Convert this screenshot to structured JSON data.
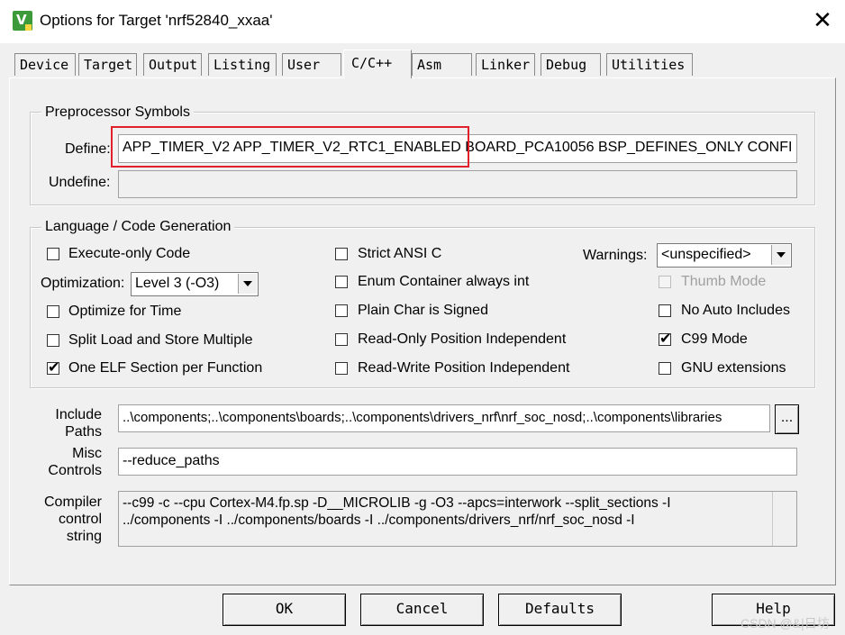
{
  "window": {
    "title": "Options for Target 'nrf52840_xxaa'",
    "close_glyph": "✕",
    "app_icon_letter": "V"
  },
  "tabs": [
    {
      "label": "Device"
    },
    {
      "label": "Target"
    },
    {
      "label": "Output"
    },
    {
      "label": "Listing"
    },
    {
      "label": "User"
    },
    {
      "label": "C/C++",
      "active": true
    },
    {
      "label": "Asm"
    },
    {
      "label": "Linker"
    },
    {
      "label": "Debug"
    },
    {
      "label": "Utilities"
    }
  ],
  "preprocessor": {
    "legend": "Preprocessor Symbols",
    "define_label": "Define:",
    "define_value": "APP_TIMER_V2 APP_TIMER_V2_RTC1_ENABLED BOARD_PCA10056 BSP_DEFINES_ONLY CONFI",
    "undefine_label": "Undefine:",
    "undefine_value": ""
  },
  "language": {
    "legend": "Language / Code Generation",
    "execute_only": {
      "label": "Execute-only Code",
      "checked": false
    },
    "optimization_label": "Optimization:",
    "optimization_value": "Level 3 (-O3)",
    "optimize_time": {
      "label": "Optimize for Time",
      "checked": false
    },
    "split_load": {
      "label": "Split Load and Store Multiple",
      "checked": false
    },
    "one_elf": {
      "label": "One ELF Section per Function",
      "checked": true
    },
    "strict_ansi": {
      "label": "Strict ANSI C",
      "checked": false
    },
    "enum_container": {
      "label": "Enum Container always int",
      "checked": false
    },
    "plain_char": {
      "label": "Plain Char is Signed",
      "checked": false
    },
    "ro_pi": {
      "label": "Read-Only Position Independent",
      "checked": false
    },
    "rw_pi": {
      "label": "Read-Write Position Independent",
      "checked": false
    },
    "warnings_label": "Warnings:",
    "warnings_value": "<unspecified>",
    "thumb_mode": {
      "label": "Thumb Mode",
      "checked": false,
      "disabled": true
    },
    "no_auto_includes": {
      "label": "No Auto Includes",
      "checked": false
    },
    "c99_mode": {
      "label": "C99 Mode",
      "checked": true
    },
    "gnu_ext": {
      "label": "GNU extensions",
      "checked": false
    }
  },
  "include": {
    "label_line1": "Include",
    "label_line2": "Paths",
    "value": "..\\components;..\\components\\boards;..\\components\\drivers_nrf\\nrf_soc_nosd;..\\components\\libraries",
    "browse_label": "..."
  },
  "misc": {
    "label_line1": "Misc",
    "label_line2": "Controls",
    "value": "--reduce_paths"
  },
  "compiler": {
    "label_line1": "Compiler",
    "label_line2": "control",
    "label_line3": "string",
    "line1": "--c99 -c --cpu Cortex-M4.fp.sp -D__MICROLIB -g -O3 --apcs=interwork --split_sections -I",
    "line2": "../components -I ../components/boards -I ../components/drivers_nrf/nrf_soc_nosd -I"
  },
  "buttons": {
    "ok": "OK",
    "cancel": "Cancel",
    "defaults": "Defaults",
    "help": "Help"
  },
  "watermark": "CSDN @&|日坊",
  "colors": {
    "highlight": "#e0202a",
    "icon_green": "#3c9a3a"
  }
}
